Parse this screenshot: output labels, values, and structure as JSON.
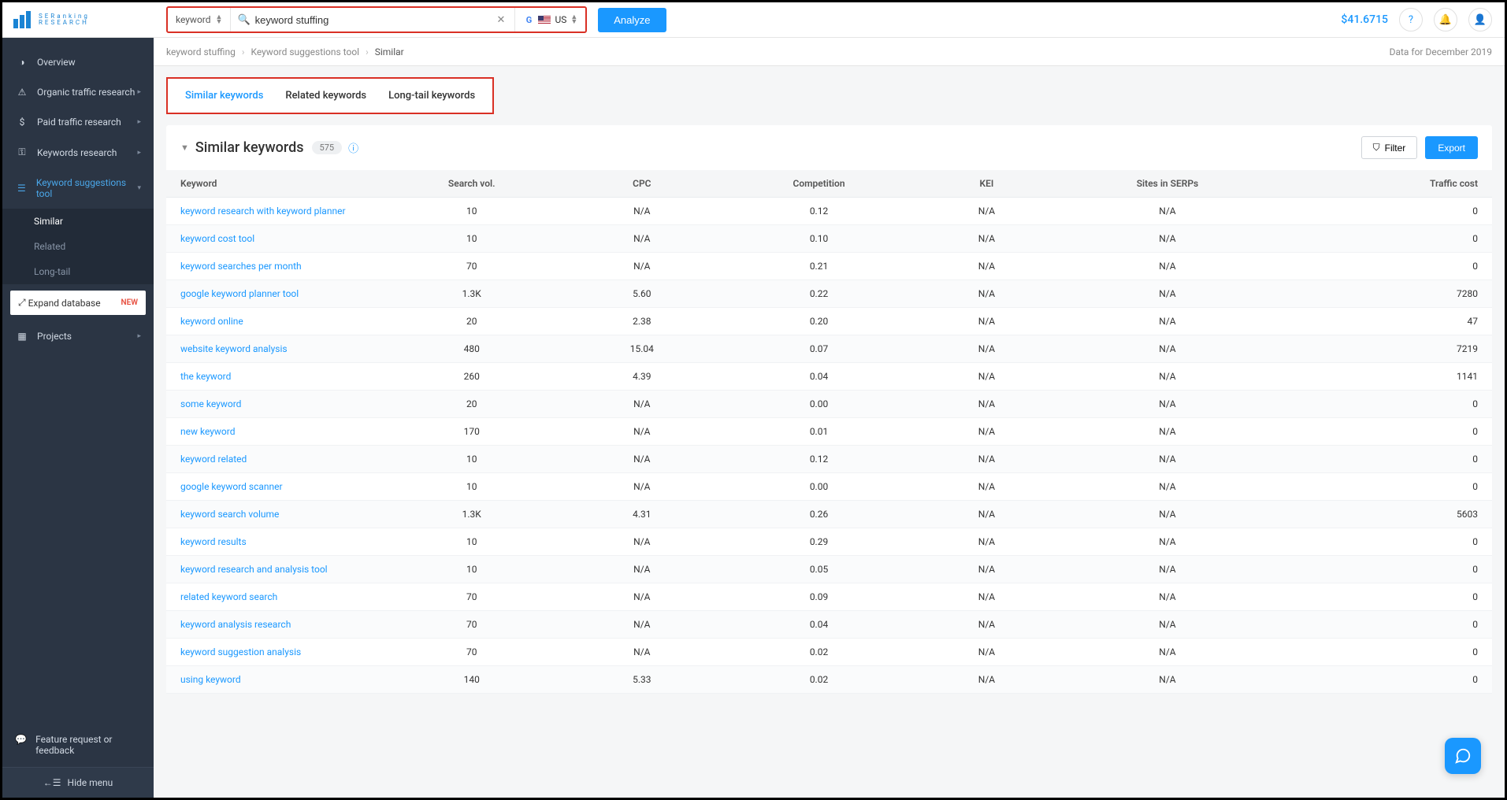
{
  "logo": {
    "name": "SERanking",
    "sub": "RESEARCH"
  },
  "sidebar": {
    "items": [
      {
        "label": "Overview"
      },
      {
        "label": "Organic traffic research"
      },
      {
        "label": "Paid traffic research"
      },
      {
        "label": "Keywords research"
      },
      {
        "label": "Keyword suggestions tool"
      }
    ],
    "sub": [
      {
        "label": "Similar"
      },
      {
        "label": "Related"
      },
      {
        "label": "Long-tail"
      }
    ],
    "expand": {
      "label": "Expand database",
      "badge": "NEW"
    },
    "projects": "Projects",
    "feature": "Feature request or feedback",
    "hide": "Hide menu"
  },
  "topbar": {
    "search_type": "keyword",
    "search_value": "keyword stuffing",
    "region": "US",
    "analyze": "Analyze",
    "balance": "$41.6715"
  },
  "breadcrumb": {
    "a": "keyword stuffing",
    "b": "Keyword suggestions tool",
    "c": "Similar",
    "right": "Data for December 2019"
  },
  "tabs": [
    {
      "label": "Similar keywords",
      "active": true
    },
    {
      "label": "Related keywords",
      "active": false
    },
    {
      "label": "Long-tail keywords",
      "active": false
    }
  ],
  "panel": {
    "title": "Similar keywords",
    "count": "575",
    "filter": "Filter",
    "export": "Export",
    "columns": [
      "Keyword",
      "Search vol.",
      "CPC",
      "Competition",
      "KEI",
      "Sites in SERPs",
      "Traffic cost"
    ]
  },
  "rows": [
    {
      "kw": "keyword research with keyword planner",
      "vol": "10",
      "cpc": "N/A",
      "comp": "0.12",
      "kei": "N/A",
      "sites": "N/A",
      "cost": "0"
    },
    {
      "kw": "keyword cost tool",
      "vol": "10",
      "cpc": "N/A",
      "comp": "0.10",
      "kei": "N/A",
      "sites": "N/A",
      "cost": "0"
    },
    {
      "kw": "keyword searches per month",
      "vol": "70",
      "cpc": "N/A",
      "comp": "0.21",
      "kei": "N/A",
      "sites": "N/A",
      "cost": "0"
    },
    {
      "kw": "google keyword planner tool",
      "vol": "1.3K",
      "cpc": "5.60",
      "comp": "0.22",
      "kei": "N/A",
      "sites": "N/A",
      "cost": "7280"
    },
    {
      "kw": "keyword online",
      "vol": "20",
      "cpc": "2.38",
      "comp": "0.20",
      "kei": "N/A",
      "sites": "N/A",
      "cost": "47"
    },
    {
      "kw": "website keyword analysis",
      "vol": "480",
      "cpc": "15.04",
      "comp": "0.07",
      "kei": "N/A",
      "sites": "N/A",
      "cost": "7219"
    },
    {
      "kw": "the keyword",
      "vol": "260",
      "cpc": "4.39",
      "comp": "0.04",
      "kei": "N/A",
      "sites": "N/A",
      "cost": "1141"
    },
    {
      "kw": "some keyword",
      "vol": "20",
      "cpc": "N/A",
      "comp": "0.00",
      "kei": "N/A",
      "sites": "N/A",
      "cost": "0"
    },
    {
      "kw": "new keyword",
      "vol": "170",
      "cpc": "N/A",
      "comp": "0.01",
      "kei": "N/A",
      "sites": "N/A",
      "cost": "0"
    },
    {
      "kw": "keyword related",
      "vol": "10",
      "cpc": "N/A",
      "comp": "0.12",
      "kei": "N/A",
      "sites": "N/A",
      "cost": "0"
    },
    {
      "kw": "google keyword scanner",
      "vol": "10",
      "cpc": "N/A",
      "comp": "0.00",
      "kei": "N/A",
      "sites": "N/A",
      "cost": "0"
    },
    {
      "kw": "keyword search volume",
      "vol": "1.3K",
      "cpc": "4.31",
      "comp": "0.26",
      "kei": "N/A",
      "sites": "N/A",
      "cost": "5603"
    },
    {
      "kw": "keyword results",
      "vol": "10",
      "cpc": "N/A",
      "comp": "0.29",
      "kei": "N/A",
      "sites": "N/A",
      "cost": "0"
    },
    {
      "kw": "keyword research and analysis tool",
      "vol": "10",
      "cpc": "N/A",
      "comp": "0.05",
      "kei": "N/A",
      "sites": "N/A",
      "cost": "0"
    },
    {
      "kw": "related keyword search",
      "vol": "70",
      "cpc": "N/A",
      "comp": "0.09",
      "kei": "N/A",
      "sites": "N/A",
      "cost": "0"
    },
    {
      "kw": "keyword analysis research",
      "vol": "70",
      "cpc": "N/A",
      "comp": "0.04",
      "kei": "N/A",
      "sites": "N/A",
      "cost": "0"
    },
    {
      "kw": "keyword suggestion analysis",
      "vol": "70",
      "cpc": "N/A",
      "comp": "0.02",
      "kei": "N/A",
      "sites": "N/A",
      "cost": "0"
    },
    {
      "kw": "using keyword",
      "vol": "140",
      "cpc": "5.33",
      "comp": "0.02",
      "kei": "N/A",
      "sites": "N/A",
      "cost": "0"
    }
  ]
}
